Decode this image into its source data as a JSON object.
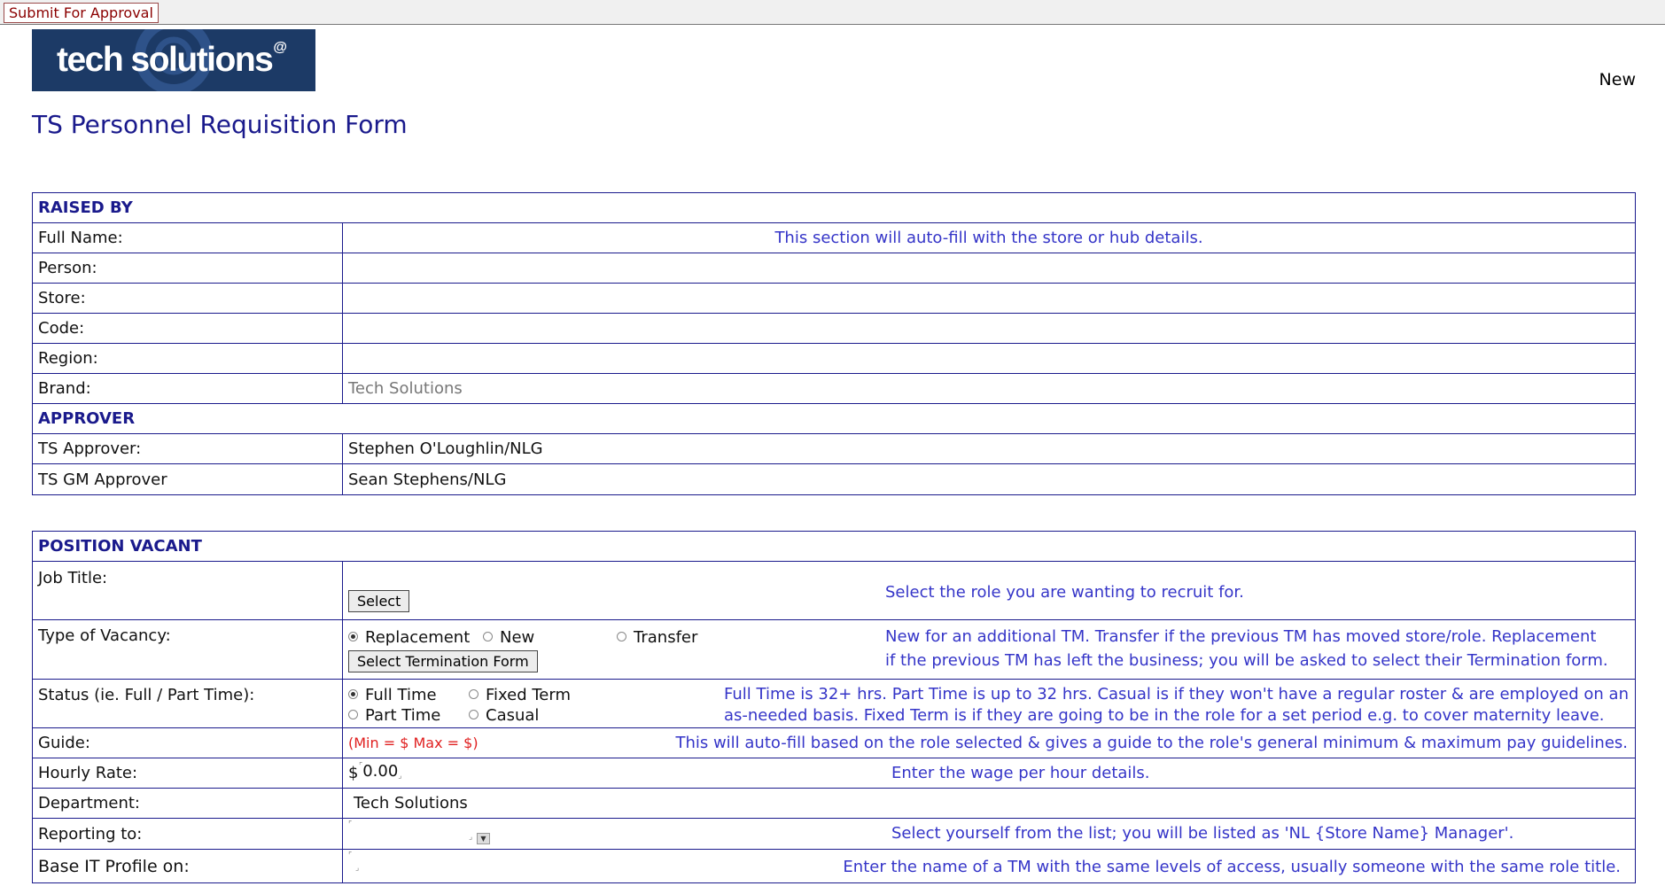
{
  "toolbar": {
    "submit_label": "Submit For Approval"
  },
  "logo": {
    "text": "tech solutions",
    "mark": "@"
  },
  "doc_status": "New",
  "page_title": "TS Personnel Requisition Form",
  "raised_by": {
    "heading": "RAISED BY",
    "rows": [
      {
        "label": "Full Name:",
        "value": "This section will auto-fill with the store or hub details."
      },
      {
        "label": "Person:",
        "value": ""
      },
      {
        "label": "Store:",
        "value": ""
      },
      {
        "label": "Code:",
        "value": ""
      },
      {
        "label": "Region:",
        "value": ""
      },
      {
        "label": "Brand:",
        "value": "Tech Solutions"
      }
    ]
  },
  "approver": {
    "heading": "APPROVER",
    "ts_label": "TS Approver:",
    "ts_value": "Stephen O'Loughlin/NLG",
    "gm_label": "TS GM Approver",
    "gm_value": "Sean Stephens/NLG"
  },
  "position": {
    "heading": "POSITION VACANT",
    "job_title": {
      "label": "Job Title:",
      "button": "Select",
      "hint": "Select the role you are wanting to recruit for."
    },
    "vacancy": {
      "label": "Type of Vacancy:",
      "options": [
        "Replacement",
        "New",
        "Transfer"
      ],
      "selected": "Replacement",
      "button": "Select Termination Form",
      "hint_line1": "New for an additional TM. Transfer if the previous TM has moved store/role. Replacement",
      "hint_line2": "if the previous TM has left the business; you will be asked to select their Termination form."
    },
    "status": {
      "label": "Status (ie. Full / Part Time):",
      "options": [
        "Full Time",
        "Fixed Term",
        "Part Time",
        "Casual"
      ],
      "selected": "Full Time",
      "hint_line1": "Full Time is 32+ hrs. Part Time is up to 32 hrs. Casual is if they won't have a regular roster & are employed on an",
      "hint_line2": "as-needed basis. Fixed Term is if they are going to be in the role for a set period e.g. to cover maternity leave."
    },
    "guide": {
      "label": "Guide:",
      "value": "(Min = $  Max = $)",
      "hint": "This will auto-fill based on the role selected & gives a guide to the role's general minimum & maximum pay guidelines."
    },
    "hourly": {
      "label": "Hourly Rate:",
      "currency": "$",
      "value": "0.00",
      "hint": "Enter the wage per hour details."
    },
    "department": {
      "label": "Department:",
      "value": "Tech Solutions"
    },
    "reporting": {
      "label": "Reporting to:",
      "hint": "Select yourself from the list; you will be listed as 'NL {Store Name} Manager'."
    },
    "base_it": {
      "label": "Base IT Profile on:",
      "hint": "Enter the name of a TM with the same levels of access, usually someone with the same role title."
    }
  },
  "colors": {
    "heading": "#1a1a8c",
    "hint": "#3535c8",
    "warning": "#e02020",
    "logo_bg": "#1c3a66"
  }
}
